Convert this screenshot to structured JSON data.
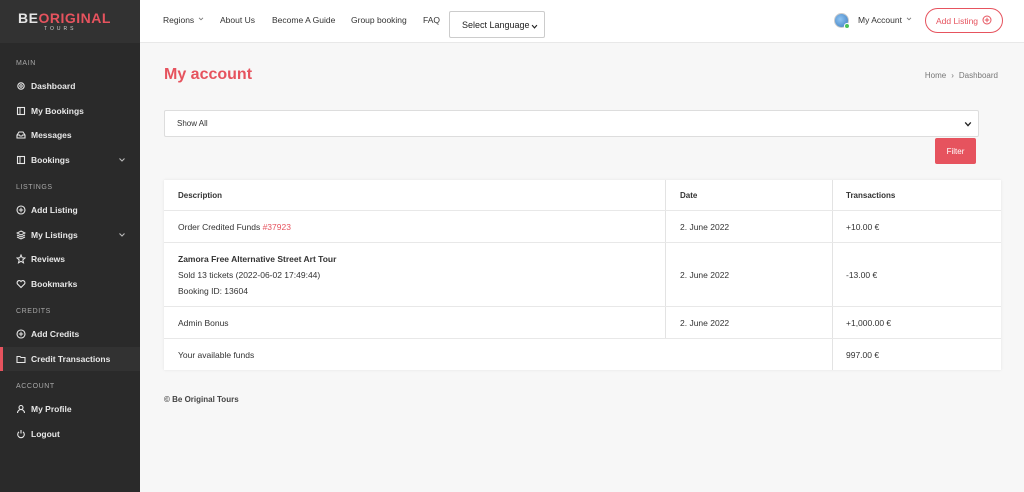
{
  "logo": {
    "part1": "BE",
    "part2": "ORIGINAL",
    "sub": "TOURS"
  },
  "sidebar": {
    "sections": [
      {
        "title": "MAIN"
      },
      {
        "title": "LISTINGS"
      },
      {
        "title": "CREDITS"
      },
      {
        "title": "ACCOUNT"
      }
    ],
    "items": [
      {
        "label": "Dashboard",
        "icon": "gear-icon"
      },
      {
        "label": "My Bookings",
        "icon": "book-icon"
      },
      {
        "label": "Messages",
        "icon": "inbox-icon"
      },
      {
        "label": "Bookings",
        "icon": "book-icon"
      },
      {
        "label": "Add Listing",
        "icon": "plus-circle-icon"
      },
      {
        "label": "My Listings",
        "icon": "layers-icon"
      },
      {
        "label": "Reviews",
        "icon": "star-icon"
      },
      {
        "label": "Bookmarks",
        "icon": "heart-icon"
      },
      {
        "label": "Add Credits",
        "icon": "plus-circle-icon"
      },
      {
        "label": "Credit Transactions",
        "icon": "folder-icon"
      },
      {
        "label": "My Profile",
        "icon": "user-icon"
      },
      {
        "label": "Logout",
        "icon": "power-icon"
      }
    ]
  },
  "header": {
    "nav": [
      "Regions",
      "About Us",
      "Become A Guide",
      "Group booking",
      "FAQ"
    ],
    "language_select": "Select Language",
    "account_label": "My Account",
    "add_listing": "Add Listing"
  },
  "main": {
    "title": "My account",
    "breadcrumb": [
      "Home",
      "Dashboard"
    ],
    "filter_select": "Show All",
    "filter_button": "Filter",
    "table": {
      "headers": [
        "Description",
        "Date",
        "Transactions"
      ],
      "rows": [
        {
          "desc": "Order Credited Funds ",
          "link": "#37923",
          "date": "2. June 2022",
          "amount": "+10.00 €"
        },
        {
          "desc_title": "Zamora Free Alternative Street Art Tour",
          "desc_line2": "Sold 13 tickets (2022-06-02 17:49:44)",
          "desc_line3": "Booking ID: 13604",
          "date": "2. June 2022",
          "amount": "-13.00 €"
        },
        {
          "desc": "Admin Bonus",
          "date": "2. June 2022",
          "amount": "+1,000.00 €"
        }
      ],
      "total_label": "Your available funds",
      "total_amount": "997.00 €"
    }
  },
  "footer": {
    "text": "© Be Original Tours"
  },
  "colors": {
    "accent": "#e6535e",
    "sidebar_bg": "#2a2a2a"
  }
}
